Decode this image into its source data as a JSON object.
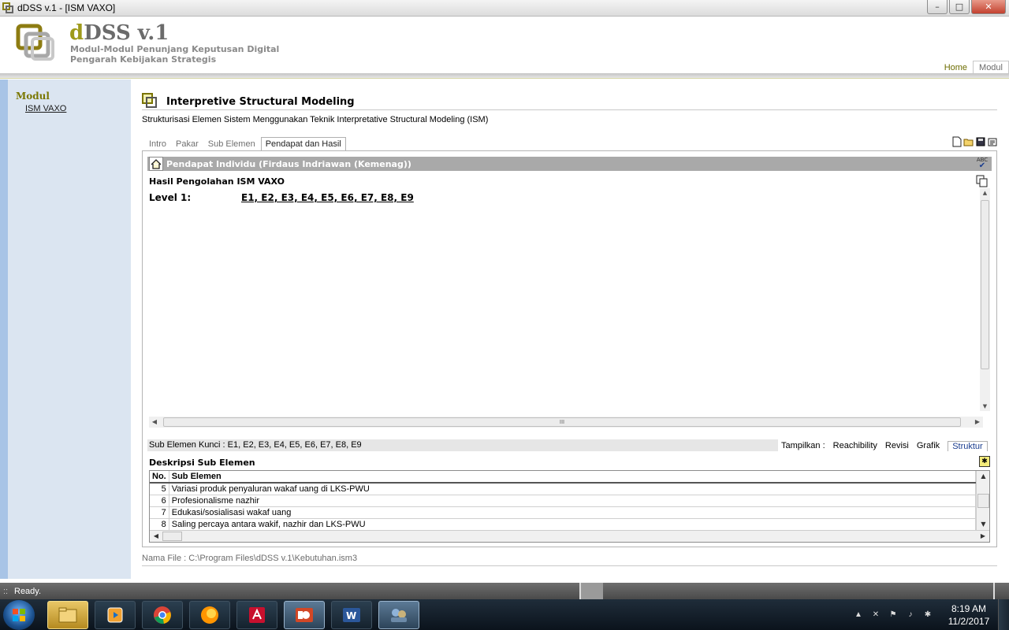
{
  "window": {
    "title": "dDSS v.1 - [ISM VAXO]",
    "controls": {
      "minimize": "–",
      "maximize": "□",
      "close": "✕"
    }
  },
  "header": {
    "brand_d": "d",
    "brand_rest": "DSS v.1",
    "subtitle_line1": "Modul-Modul Penunjang Keputusan Digital",
    "subtitle_line2": "Pengarah Kebijakan Strategis",
    "nav": [
      {
        "label": "Home"
      },
      {
        "label": "Modul"
      }
    ]
  },
  "sidebar": {
    "section_label": "Modul",
    "items": [
      {
        "label": "ISM VAXO"
      }
    ]
  },
  "main": {
    "title": "Interpretive Structural Modeling",
    "description": "Strukturisasi Elemen Sistem Menggunakan Teknik Interpretative Structural Modeling (ISM)",
    "tabs": [
      {
        "label": "Intro"
      },
      {
        "label": "Pakar"
      },
      {
        "label": "Sub Elemen"
      },
      {
        "label": "Pendapat dan Hasil"
      }
    ],
    "panel": {
      "title": "Pendapat Individu (Firdaus Indriawan (Kemenag))",
      "abc_icon": "ABC",
      "result_title": "Hasil Pengolahan ISM VAXO",
      "level_label": "Level 1:",
      "level_value": "E1, E2, E3, E4, E5, E6, E7, E8, E9",
      "hscroll_grip": "III"
    },
    "key_subelements": "Sub Elemen Kunci : E1, E2, E3, E4, E5, E6, E7, E8, E9",
    "view_options": {
      "label": "Tampilkan :",
      "items": [
        "Reachibility",
        "Revisi",
        "Grafik",
        "Struktur"
      ]
    },
    "desc_title": "Deskripsi Sub Elemen",
    "grid": {
      "columns": [
        "No.",
        "Sub Elemen"
      ],
      "rows": [
        {
          "no": "5",
          "text": "Variasi produk penyaluran wakaf uang di LKS-PWU"
        },
        {
          "no": "6",
          "text": "Profesionalisme nazhir"
        },
        {
          "no": "7",
          "text": "Edukasi/sosialisasi wakaf uang"
        },
        {
          "no": "8",
          "text": "Saling percaya antara wakif, nazhir dan LKS-PWU"
        }
      ]
    },
    "filename": "Nama File : C:\\Program Files\\dDSS v.1\\Kebutuhan.ism3"
  },
  "statusbar": {
    "grip": "::",
    "text": "Ready."
  },
  "taskbar": {
    "apps": [
      "file-explorer-icon",
      "media-player-icon",
      "chrome-icon",
      "firefox-icon",
      "acrobat-icon",
      "powerpoint-icon",
      "word-icon",
      "ddss-app-icon"
    ],
    "clock_time": "8:19 AM",
    "clock_date": "11/2/2017"
  },
  "colors": {
    "accent": "#9e9a1a",
    "sidebar_bg": "#dbe5f1",
    "panel_header": "#a9a9a9"
  }
}
